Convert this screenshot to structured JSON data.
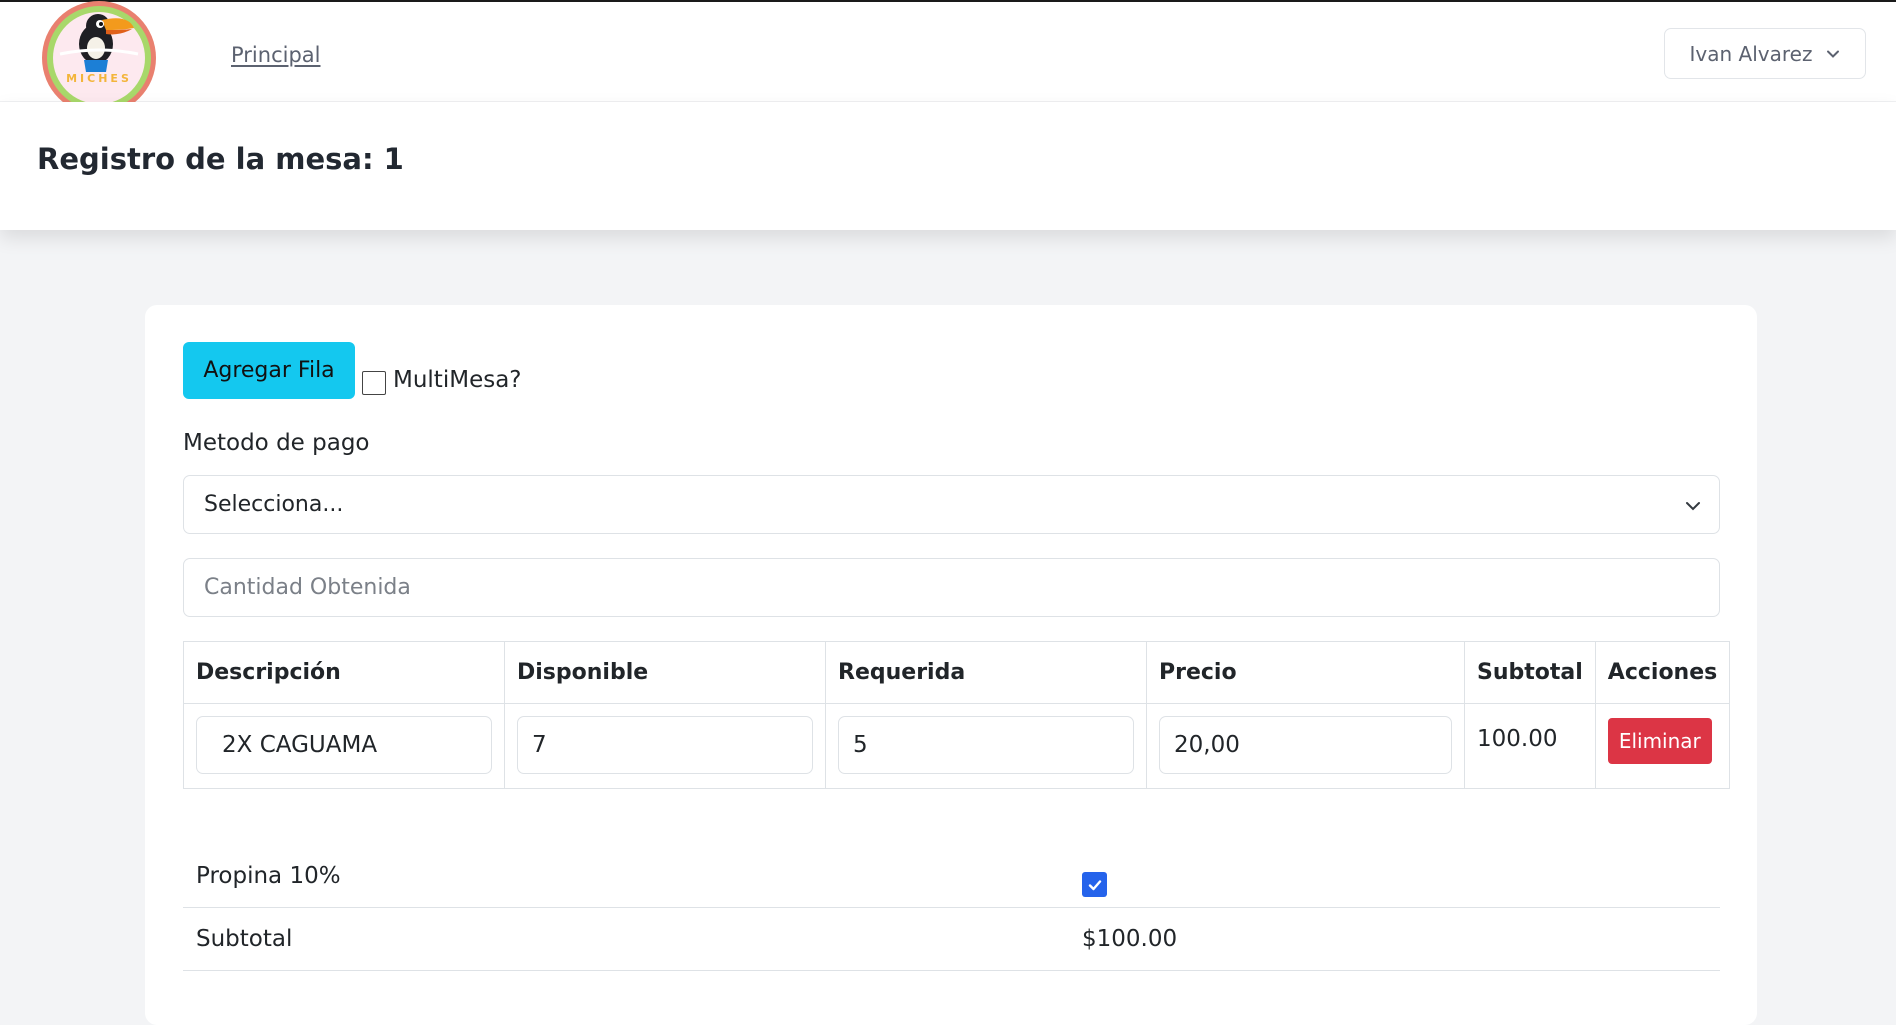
{
  "nav": {
    "brand_text": "MICHES",
    "link_principal": "Principal",
    "user_name": "Ivan Alvarez"
  },
  "header": {
    "title": "Registro de la mesa: 1"
  },
  "form": {
    "add_row_label": "Agregar Fila",
    "multimesa_label": "MultiMesa?",
    "multimesa_checked": false,
    "payment_label": "Metodo de pago",
    "payment_selected": "Selecciona...",
    "amount_placeholder": "Cantidad Obtenida"
  },
  "table": {
    "headers": [
      "Descripción",
      "Disponible",
      "Requerida",
      "Precio",
      "Subtotal",
      "Acciones"
    ],
    "rows": [
      {
        "descripcion": "2X CAGUAMA",
        "disponible": "7",
        "requerida": "5",
        "precio": "20,00",
        "subtotal": "100.00",
        "accion": "Eliminar"
      }
    ]
  },
  "totals": {
    "propina_label": "Propina 10%",
    "propina_checked": true,
    "subtotal_label": "Subtotal",
    "subtotal_value": "$100.00"
  },
  "colors": {
    "primary_button": "#14c8ef",
    "danger_button": "#dc3545",
    "checkbox_on": "#2563eb"
  }
}
